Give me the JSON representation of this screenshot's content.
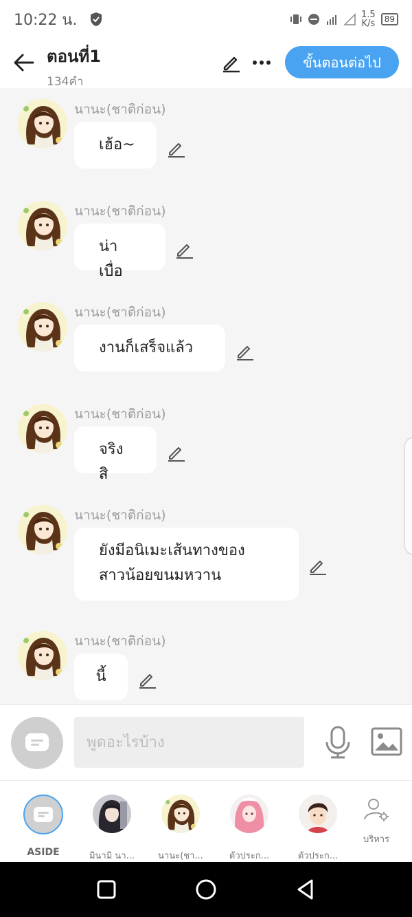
{
  "status": {
    "time": "10:22 น.",
    "speed_top": "1.5",
    "speed_bottom": "K/s",
    "battery": "89"
  },
  "header": {
    "title": "ตอนที่1",
    "subtitle": "134คำ",
    "next_label": "ขั้นตอนต่อไป"
  },
  "messages": [
    {
      "sender": "นานะ(ชาติก่อน)",
      "lines": [
        "เฮ้อ~"
      ]
    },
    {
      "sender": "นานะ(ชาติก่อน)",
      "lines": [
        "น่าเบื่อ"
      ]
    },
    {
      "sender": "นานะ(ชาติก่อน)",
      "lines": [
        "งานก็เสร็จแล้ว"
      ]
    },
    {
      "sender": "นานะ(ชาติก่อน)",
      "lines": [
        "จริงสิ"
      ]
    },
    {
      "sender": "นานะ(ชาติก่อน)",
      "lines": [
        "ยังมีอนิเมะเส้นทางของ",
        "สาวน้อยขนมหวาน"
      ]
    },
    {
      "sender": "นานะ(ชาติก่อน)",
      "lines": [
        "นี้"
      ]
    }
  ],
  "input": {
    "placeholder": "พูดอะไรบ้าง"
  },
  "characters": [
    {
      "label": "ASIDE"
    },
    {
      "label": "มินามิ นา..."
    },
    {
      "label": "นานะ(ชา..."
    },
    {
      "label": "ตัวประก..."
    },
    {
      "label": "ตัวประก..."
    },
    {
      "label": "บริหาร"
    }
  ],
  "colors": {
    "accent": "#4aa3f0",
    "background": "#f5f5f5"
  }
}
